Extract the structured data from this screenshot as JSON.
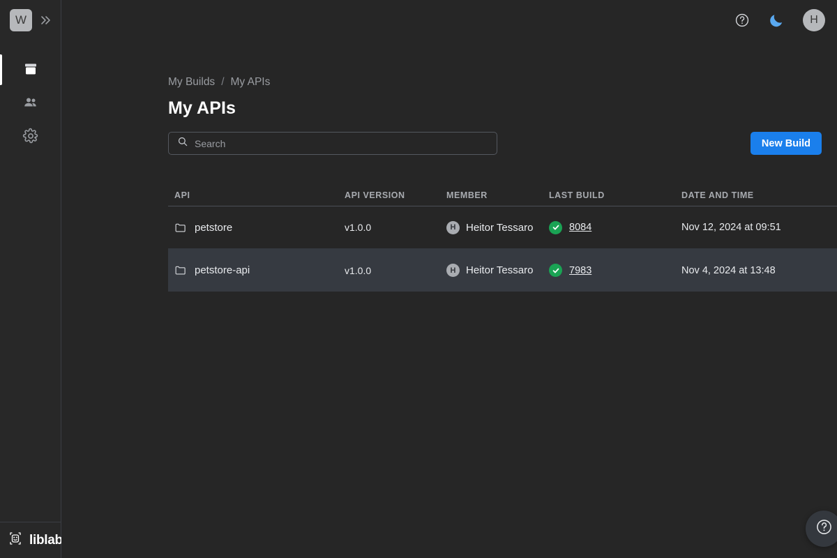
{
  "sidebar": {
    "workspace_initial": "W",
    "expand_icon": "double-chevron-right-icon",
    "items": [
      {
        "icon": "builds-box-icon",
        "name": "builds",
        "active": true
      },
      {
        "icon": "members-people-icon",
        "name": "members",
        "active": false
      },
      {
        "icon": "settings-gear-icon",
        "name": "settings",
        "active": false
      }
    ],
    "brand": {
      "logo_icon": "liblab-llama-icon",
      "wordmark": "liblab"
    }
  },
  "topbar": {
    "help_icon": "question-circle-icon",
    "theme_icon": "moon-icon",
    "theme_color": "#5aa9f0",
    "avatar_initial": "H"
  },
  "breadcrumb": {
    "parent": "My Builds",
    "separator": "/",
    "current": "My APIs"
  },
  "page": {
    "title": "My APIs"
  },
  "search": {
    "placeholder": "Search",
    "value": "",
    "icon": "search-icon"
  },
  "actions": {
    "new_build_label": "New Build",
    "accent_color": "#1a7fec"
  },
  "table": {
    "columns": [
      "API",
      "API VERSION",
      "MEMBER",
      "LAST BUILD",
      "DATE AND TIME"
    ],
    "rows": [
      {
        "api": "petstore",
        "api_version": "v1.0.0",
        "member": "Heitor Tessaro",
        "member_initial": "H",
        "build_number": "8084",
        "build_status": "success",
        "date_time": "Nov 12, 2024 at 09:51",
        "highlighted": false
      },
      {
        "api": "petstore-api",
        "api_version": "v1.0.0",
        "member": "Heitor Tessaro",
        "member_initial": "H",
        "build_number": "7983",
        "build_status": "success",
        "date_time": "Nov 4, 2024 at 13:48",
        "highlighted": true
      }
    ]
  },
  "help_fab": {
    "icon": "question-circle-icon"
  }
}
